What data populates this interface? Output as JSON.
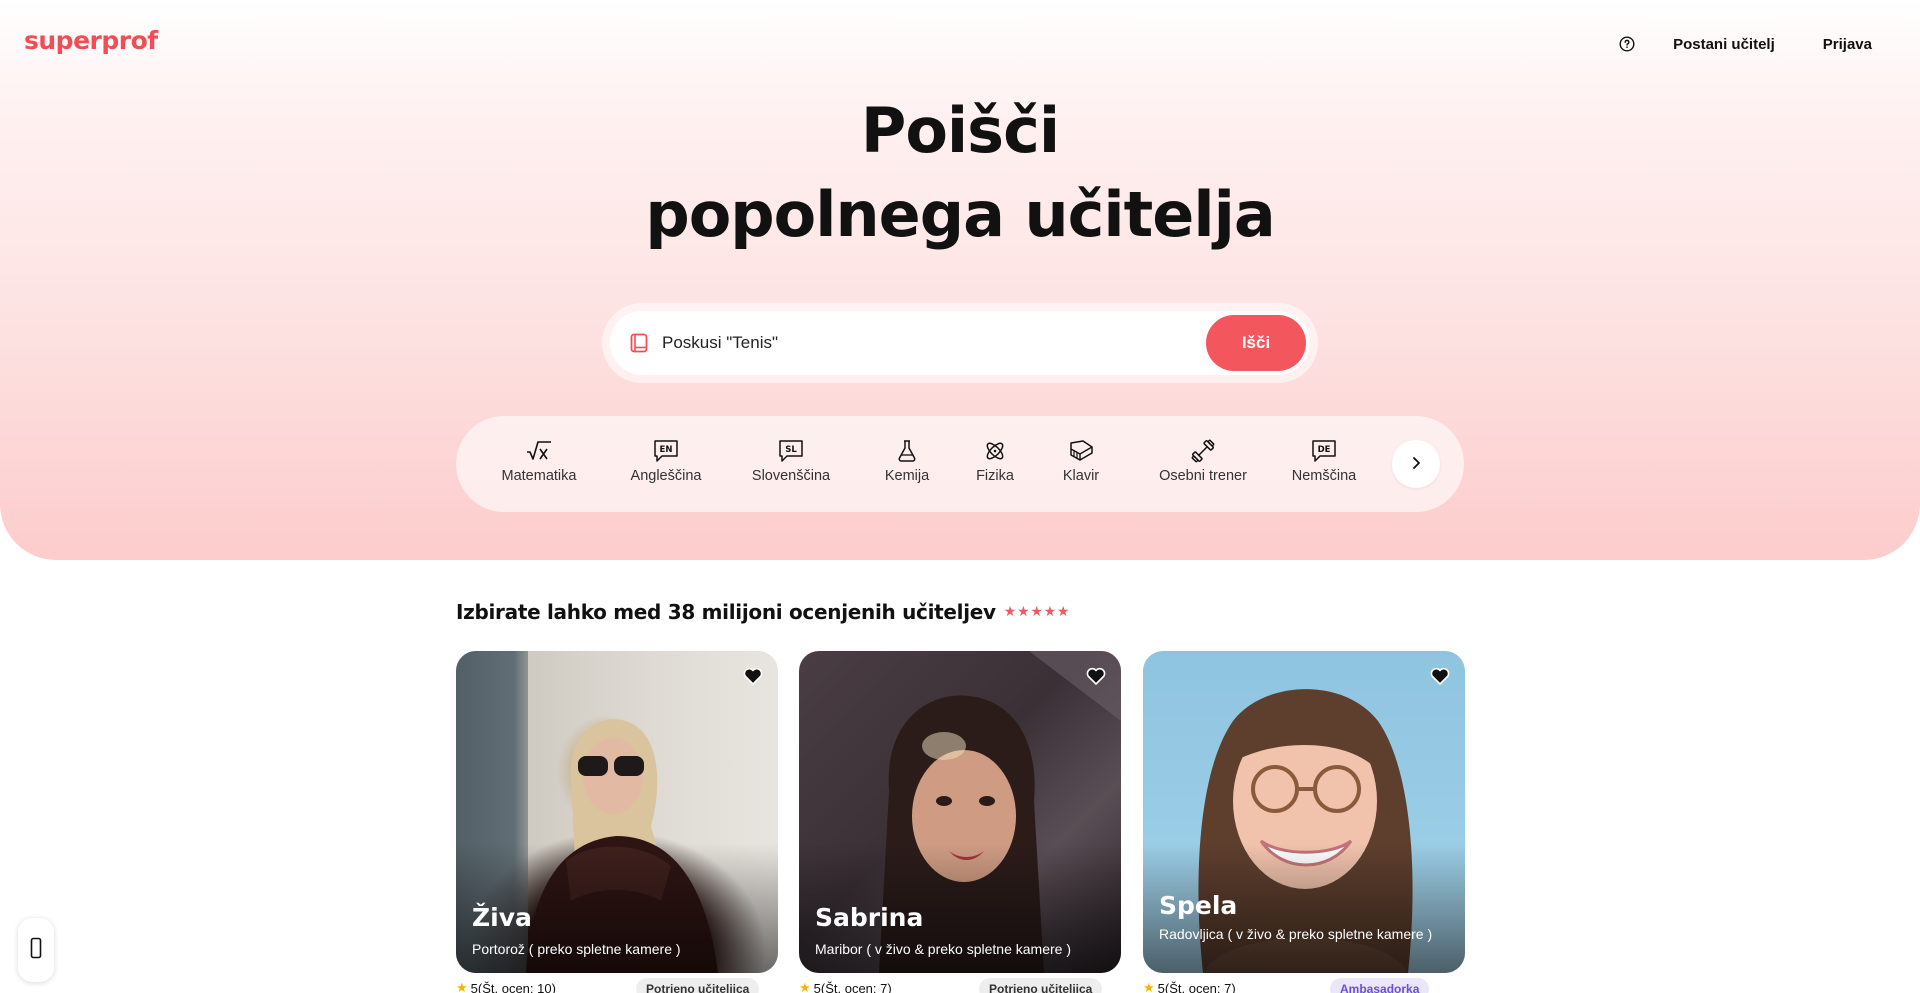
{
  "header": {
    "logo": "superprof",
    "help_icon": "question-circle-icon",
    "become_tutor": "Postani učitelj",
    "login": "Prijava"
  },
  "hero": {
    "title_line1": "Poišči",
    "title_line2": "popolnega učitelja",
    "search": {
      "icon": "book-icon",
      "placeholder": "Poskusi \"Tenis\"",
      "value": "",
      "button": "Išči"
    },
    "subjects": [
      {
        "label": "Matematika",
        "icon": "sqrt-x-icon"
      },
      {
        "label": "Angleščina",
        "icon": "en-speech-icon"
      },
      {
        "label": "Slovenščina",
        "icon": "sl-speech-icon"
      },
      {
        "label": "Kemija",
        "icon": "flask-icon"
      },
      {
        "label": "Fizika",
        "icon": "atom-icon"
      },
      {
        "label": "Klavir",
        "icon": "piano-icon"
      },
      {
        "label": "Osebni trener",
        "icon": "dumbbell-icon"
      },
      {
        "label": "Nemščina",
        "icon": "de-speech-icon"
      }
    ],
    "next_icon": "chevron-right-icon"
  },
  "tutors": {
    "title": "Izbirate lahko med 38 milijoni ocenjenih učiteljev",
    "rating_stars": 5,
    "cards": [
      {
        "name": "Živa",
        "location": "Portorož ( preko spletne kamere )",
        "rating": "5(Št. ocen: 10)",
        "badge": "Potrjeno učiteljica"
      },
      {
        "name": "Sabrina",
        "location": "Maribor ( v živo & preko spletne kamere )",
        "rating": "5(Št. ocen: 7)",
        "badge": "Potrjeno učiteljica"
      },
      {
        "name": "Spela",
        "location": "Radovljica ( v živo & preko spletne kamere )",
        "rating": "5(Št. ocen: 7)",
        "badge": "Ambasadorka"
      }
    ]
  },
  "colors": {
    "brand": "#ef4e56",
    "button": "#f4565d",
    "star": "#f05a60",
    "rating_star": "#f5b400"
  }
}
